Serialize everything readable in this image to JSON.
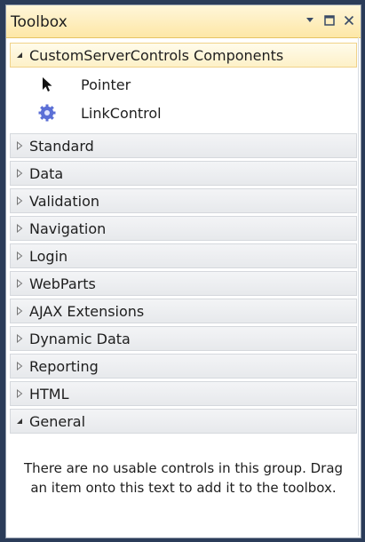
{
  "window": {
    "title": "Toolbox",
    "buttons": [
      "dropdown-icon",
      "maximize-icon",
      "close-icon"
    ]
  },
  "expanded_group": {
    "label": "CustomServerControls Components",
    "items": [
      {
        "label": "Pointer",
        "icon": "pointer-icon"
      },
      {
        "label": "LinkControl",
        "icon": "gear-icon"
      }
    ]
  },
  "groups": [
    "Standard",
    "Data",
    "Validation",
    "Navigation",
    "Login",
    "WebParts",
    "AJAX Extensions",
    "Dynamic Data",
    "Reporting",
    "HTML"
  ],
  "general_group": {
    "label": "General",
    "empty_message": "There are no usable controls in this group. Drag an item onto this text to add it to the toolbox."
  },
  "colors": {
    "titlebar": "#fde7a6",
    "selected_header": "#fdf1c8",
    "background": "#2b3c59"
  }
}
